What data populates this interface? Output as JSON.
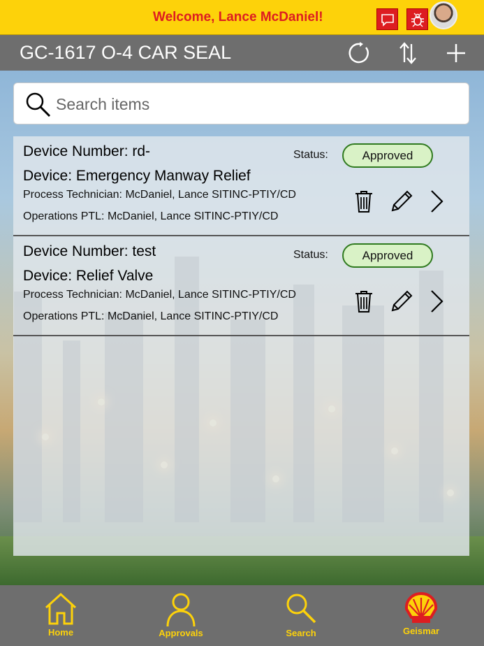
{
  "header": {
    "welcome": "Welcome, Lance McDaniel!",
    "icons": [
      "chat-icon",
      "bug-icon"
    ],
    "avatar": "user-avatar"
  },
  "titlebar": {
    "title": "GC-1617 O-4 CAR SEAL",
    "actions": [
      "refresh-icon",
      "sort-icon",
      "add-icon"
    ]
  },
  "search": {
    "placeholder": "Search items",
    "value": ""
  },
  "items": [
    {
      "device_number": "Device Number:  rd-",
      "device": "Device: Emergency Manway Relief",
      "status_label": "Status:",
      "status": "Approved",
      "process_technician": "Process Technician:  McDaniel, Lance SITINC-PTIY/CD",
      "operations_ptl": "Operations PTL:  McDaniel, Lance SITINC-PTIY/CD"
    },
    {
      "device_number": "Device Number:  test",
      "device": "Device: Relief Valve",
      "status_label": "Status:",
      "status": "Approved",
      "process_technician": "Process Technician:  McDaniel, Lance SITINC-PTIY/CD",
      "operations_ptl": "Operations PTL:  McDaniel, Lance SITINC-PTIY/CD"
    }
  ],
  "nav": [
    {
      "label": "Home",
      "icon": "home-icon"
    },
    {
      "label": "Approvals",
      "icon": "person-icon"
    },
    {
      "label": "Search",
      "icon": "search-icon"
    },
    {
      "label": "Geismar",
      "icon": "shell-logo-icon"
    }
  ],
  "colors": {
    "brand_yellow": "#fdd20a",
    "brand_red": "#dd1d21",
    "approved_bg": "#d9f2c6",
    "approved_border": "#2f7a1f"
  }
}
